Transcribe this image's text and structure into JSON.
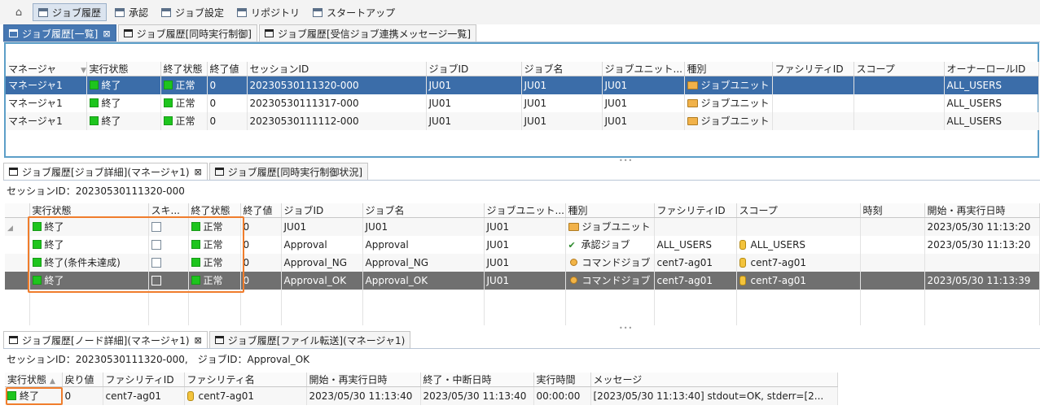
{
  "toolbar": {
    "items": [
      {
        "label": "ジョブ履歴",
        "active": true
      },
      {
        "label": "承認",
        "active": false
      },
      {
        "label": "ジョブ設定",
        "active": false
      },
      {
        "label": "リポジトリ",
        "active": false
      },
      {
        "label": "スタートアップ",
        "active": false
      }
    ]
  },
  "panel1": {
    "tabs": [
      {
        "label": "ジョブ履歴[一覧]",
        "close": "⊠"
      },
      {
        "label": "ジョブ履歴[同時実行制御]"
      },
      {
        "label": "ジョブ履歴[受信ジョブ連携メッセージ一覧]"
      }
    ],
    "columns": [
      "マネージャ",
      "実行状態",
      "終了状態",
      "終了値",
      "セッションID",
      "ジョブID",
      "ジョブ名",
      "ジョブユニット...",
      "種別",
      "ファシリティID",
      "スコープ",
      "オーナーロールID"
    ],
    "rows": [
      {
        "manager": "マネージャ1",
        "run_state": "終了",
        "end_state": "正常",
        "end_value": "0",
        "session_id": "20230530111320-000",
        "job_id": "JU01",
        "job_name": "JU01",
        "jobunit": "JU01",
        "type": "ジョブユニット",
        "facility": "",
        "scope": "",
        "owner": "ALL_USERS"
      },
      {
        "manager": "マネージャ1",
        "run_state": "終了",
        "end_state": "正常",
        "end_value": "0",
        "session_id": "20230530111317-000",
        "job_id": "JU01",
        "job_name": "JU01",
        "jobunit": "JU01",
        "type": "ジョブユニット",
        "facility": "",
        "scope": "",
        "owner": "ALL_USERS"
      },
      {
        "manager": "マネージャ1",
        "run_state": "終了",
        "end_state": "正常",
        "end_value": "0",
        "session_id": "20230530111112-000",
        "job_id": "JU01",
        "job_name": "JU01",
        "jobunit": "JU01",
        "type": "ジョブユニット",
        "facility": "",
        "scope": "",
        "owner": "ALL_USERS"
      }
    ]
  },
  "panel2": {
    "tabs": [
      {
        "label": "ジョブ履歴[ジョブ詳細](マネージャ1)",
        "close": "⊠"
      },
      {
        "label": "ジョブ履歴[同時実行制御状況]"
      }
    ],
    "session_info": "セッションID：20230530111320-000",
    "columns": [
      "実行状態",
      "スキ...",
      "終了状態",
      "終了値",
      "ジョブID",
      "ジョブ名",
      "ジョブユニット...",
      "種別",
      "ファシリティID",
      "スコープ",
      "時刻",
      "開始・再実行日時"
    ],
    "rows": [
      {
        "run_state": "終了",
        "end_state": "正常",
        "end_value": "0",
        "job_id": "JU01",
        "job_name": "JU01",
        "jobunit": "JU01",
        "type": "ジョブユニット",
        "type_icon": "folder-icon",
        "facility": "",
        "scope": "",
        "time": "",
        "start": "2023/05/30 11:13:20"
      },
      {
        "run_state": "終了",
        "end_state": "正常",
        "end_value": "0",
        "job_id": "Approval",
        "job_name": "Approval",
        "jobunit": "JU01",
        "type": "承認ジョブ",
        "type_icon": "check-icon",
        "facility": "ALL_USERS",
        "scope": "ALL_USERS",
        "time": "",
        "start": "2023/05/30 11:13:20"
      },
      {
        "run_state": "終了(条件未達成)",
        "end_state": "正常",
        "end_value": "0",
        "job_id": "Approval_NG",
        "job_name": "Approval_NG",
        "jobunit": "JU01",
        "type": "コマンドジョブ",
        "type_icon": "dot-icon",
        "facility": "cent7-ag01",
        "scope": "cent7-ag01",
        "time": "",
        "start": ""
      },
      {
        "run_state": "終了",
        "end_state": "正常",
        "end_value": "0",
        "job_id": "Approval_OK",
        "job_name": "Approval_OK",
        "jobunit": "JU01",
        "type": "コマンドジョブ",
        "type_icon": "dot-icon",
        "facility": "cent7-ag01",
        "scope": "cent7-ag01",
        "time": "",
        "start": "2023/05/30 11:13:39"
      }
    ]
  },
  "panel3": {
    "tabs": [
      {
        "label": "ジョブ履歴[ノード詳細](マネージャ1)",
        "close": "⊠"
      },
      {
        "label": "ジョブ履歴[ファイル転送](マネージャ1)"
      }
    ],
    "session_info": "セッションID：20230530111320-000,　ジョブID：Approval_OK",
    "columns": [
      "実行状態",
      "戻り値",
      "ファシリティID",
      "ファシリティ名",
      "開始・再実行日時",
      "終了・中断日時",
      "実行時間",
      "メッセージ"
    ],
    "rows": [
      {
        "run_state": "終了",
        "ret": "0",
        "facility_id": "cent7-ag01",
        "facility_name": "cent7-ag01",
        "start": "2023/05/30 11:13:40",
        "end": "2023/05/30 11:13:40",
        "elapsed": "00:00:00",
        "message": "[2023/05/30 11:13:40] stdout=OK, stderr=[2..."
      }
    ]
  },
  "colors": {
    "accent": "#3b6da9",
    "status_green": "#1ec51e",
    "highlight": "#f07d2c",
    "frame": "#5d9fc8"
  }
}
